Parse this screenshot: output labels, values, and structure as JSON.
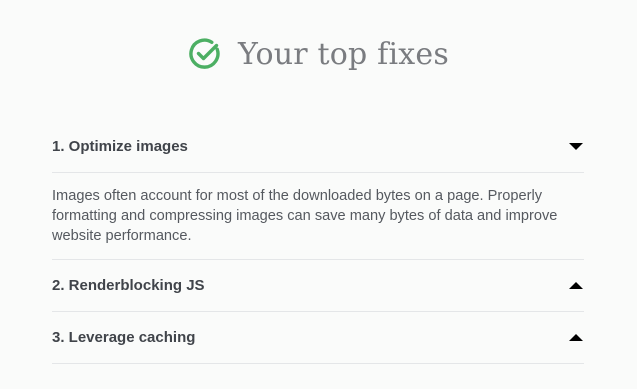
{
  "header": {
    "title": "Your top fixes",
    "icon": "check-circle-icon",
    "icon_color": "#4caf63"
  },
  "fixes": [
    {
      "label": "1. Optimize images",
      "expanded": true,
      "caret": "down",
      "description": "Images often account for most of the downloaded bytes on a page. Properly formatting and compressing images can save many bytes of data and improve website performance."
    },
    {
      "label": "2. Renderblocking JS",
      "expanded": false,
      "caret": "up"
    },
    {
      "label": "3. Leverage caching",
      "expanded": false,
      "caret": "up"
    }
  ]
}
